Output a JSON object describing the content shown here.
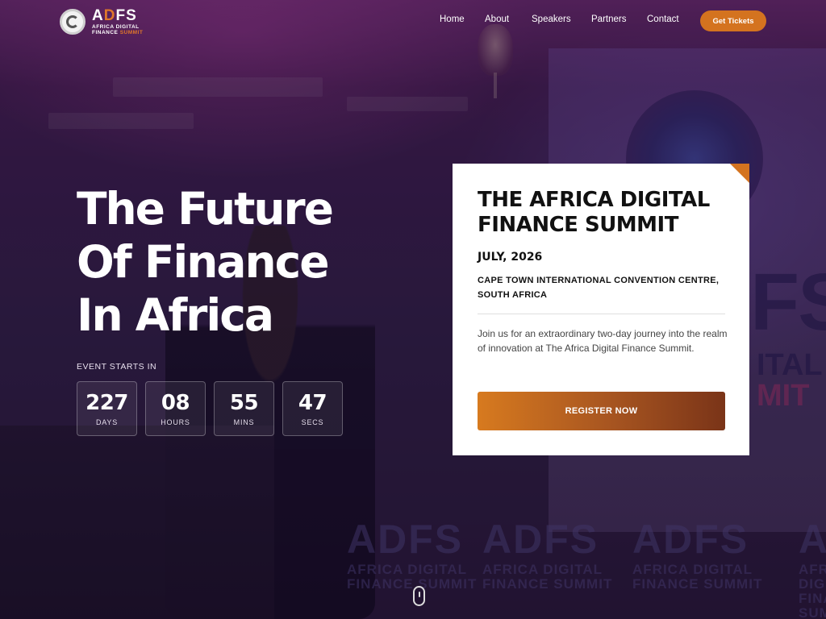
{
  "brand": {
    "logo_main_a": "A",
    "logo_main_d": "D",
    "logo_main_fs": "FS",
    "logo_sub_line1": "AFRICA DIGITAL",
    "logo_sub_line2_a": "FINANCE",
    "logo_sub_line2_b": "SUMMIT",
    "accent_color": "#d4731f"
  },
  "nav": {
    "items": [
      {
        "label": "Home"
      },
      {
        "label": "About"
      },
      {
        "label": "Speakers"
      },
      {
        "label": "Partners"
      },
      {
        "label": "Contact"
      }
    ],
    "cta_label": "Get Tickets"
  },
  "hero": {
    "title_lines": [
      "The Future",
      "Of Finance",
      "In Africa"
    ],
    "countdown_label": "EVENT STARTS IN",
    "countdown": [
      {
        "value": "227",
        "unit": "DAYS"
      },
      {
        "value": "08",
        "unit": "HOURS"
      },
      {
        "value": "55",
        "unit": "MINS"
      },
      {
        "value": "47",
        "unit": "SECS"
      }
    ]
  },
  "card": {
    "title": "THE AFRICA DIGITAL FINANCE SUMMIT",
    "date": "JULY, 2026",
    "venue": "CAPE TOWN INTERNATIONAL CONVENTION CENTRE, SOUTH AFRICA",
    "description": "Join us for an extraordinary two-day journey into the realm of innovation at The Africa Digital Finance Summit.",
    "register_label": "REGISTER NOW"
  },
  "background": {
    "wall_letters": "FS",
    "wall_word1": "ITAL",
    "wall_word2": "MIT",
    "banner_big": "ADFS",
    "banner_line1": "AFRICA DIGITAL",
    "banner_line2": "FINANCE SUMMIT"
  }
}
